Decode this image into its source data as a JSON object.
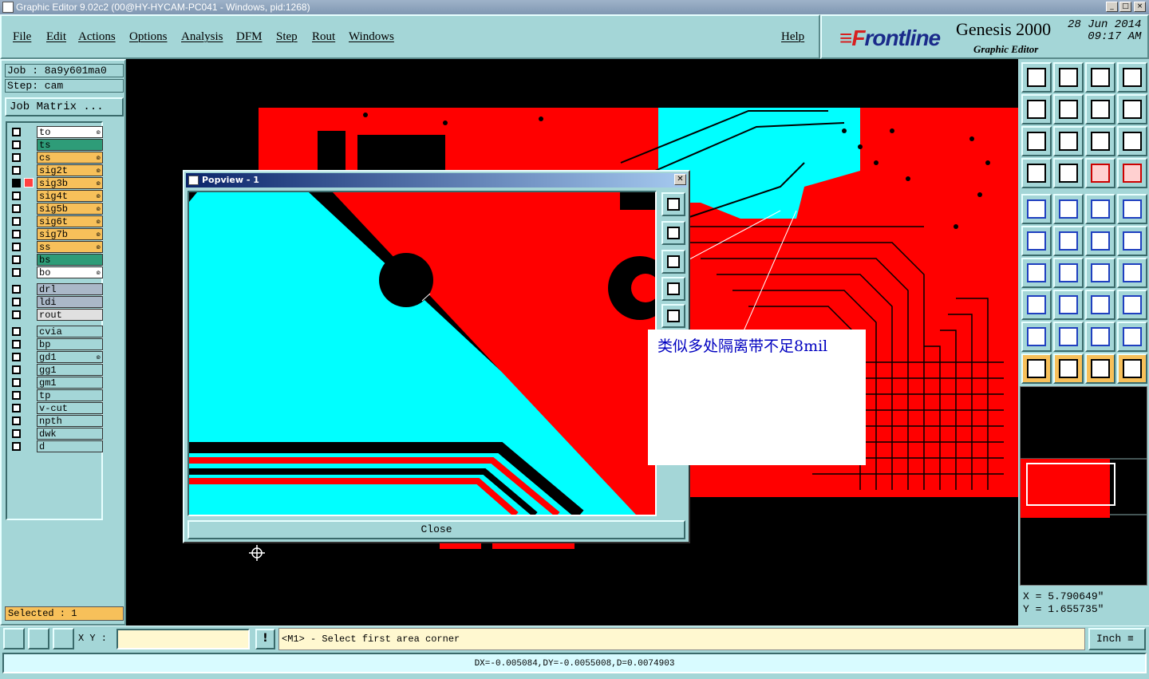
{
  "window": {
    "title": "Graphic Editor 9.02c2 (00@HY-HYCAM-PC041 - Windows, pid:1268)",
    "min": "_",
    "max": "□",
    "close": "×"
  },
  "menu": [
    "File",
    "Edit",
    "Actions",
    "Options",
    "Analysis",
    "DFM",
    "Step",
    "Rout",
    "Windows"
  ],
  "help": "Help",
  "brand": {
    "logo_f": "≡F",
    "logo_rest": "rontline",
    "product": "Genesis 2000",
    "subtitle": "Graphic Editor",
    "date": "28 Jun 2014",
    "time": "09:17 AM"
  },
  "job": {
    "job_line": "Job : 8a9y601ma0",
    "step_line": "Step: cam",
    "matrix_button": "Job Matrix ..."
  },
  "layers": [
    {
      "name": "to",
      "color": "#ffffff",
      "w": "๏"
    },
    {
      "name": "ts",
      "color": "#2e9c78",
      "w": ""
    },
    {
      "name": "cs",
      "color": "#f7c05a",
      "w": "๏"
    },
    {
      "name": "sig2t",
      "color": "#f7c05a",
      "w": "๏"
    },
    {
      "name": "sig3b",
      "color": "#f7c05a",
      "w": "๏"
    },
    {
      "name": "sig4t",
      "color": "#f7c05a",
      "w": "๏"
    },
    {
      "name": "sig5b",
      "color": "#f7c05a",
      "w": "๏"
    },
    {
      "name": "sig6t",
      "color": "#f7c05a",
      "w": "๏"
    },
    {
      "name": "sig7b",
      "color": "#f7c05a",
      "w": "๏"
    },
    {
      "name": "ss",
      "color": "#f7c05a",
      "w": "๏"
    },
    {
      "name": "bs",
      "color": "#2e9c78",
      "w": ""
    },
    {
      "name": "bo",
      "color": "#ffffff",
      "w": "๏"
    },
    {
      "name": "drl",
      "color": "#aab8c8",
      "w": ""
    },
    {
      "name": "ldi",
      "color": "#aab8c8",
      "w": ""
    },
    {
      "name": "rout",
      "color": "#e0e0e0",
      "w": ""
    },
    {
      "name": "cvia",
      "color": "#a4d6d7",
      "w": ""
    },
    {
      "name": "bp",
      "color": "#a4d6d7",
      "w": ""
    },
    {
      "name": "gd1",
      "color": "#a4d6d7",
      "w": "๏"
    },
    {
      "name": "gg1",
      "color": "#a4d6d7",
      "w": ""
    },
    {
      "name": "gm1",
      "color": "#a4d6d7",
      "w": ""
    },
    {
      "name": "tp",
      "color": "#a4d6d7",
      "w": ""
    },
    {
      "name": "v-cut",
      "color": "#a4d6d7",
      "w": ""
    },
    {
      "name": "npth",
      "color": "#a4d6d7",
      "w": ""
    },
    {
      "name": "dwk",
      "color": "#a4d6d7",
      "w": ""
    },
    {
      "name": "d",
      "color": "#a4d6d7",
      "w": ""
    }
  ],
  "selected": "Selected : 1",
  "popview": {
    "title": "Popview - 1",
    "close_label": "Close"
  },
  "annotation": "类似多处隔离带不足8mil",
  "coords": {
    "x": "X = 5.790649\"",
    "y": "Y = 1.655735\""
  },
  "bottom": {
    "xy_label": "X Y :",
    "xy_value": "",
    "bang": "!",
    "prompt": "<M1> - Select first area corner",
    "unit": "Inch ≡"
  },
  "status": "DX=-0.005084,DY=-0.0055008,D=0.0074903",
  "colors": {
    "panel": "#a4d6d7",
    "copper": "#ff0000",
    "plane": "#00ffff",
    "highlight": "#f7c05a"
  },
  "toolbar_icons": [
    "zoom-home-icon",
    "zoom-home-icon",
    "home-icon",
    "window-icon",
    "pan-left-icon",
    "pan-right-icon",
    "redraw-icon",
    "snap-icon",
    "zoom-fit-icon",
    "zoom-center-icon",
    "scale-icon",
    "help-icon",
    "measure-icon",
    "drill-icon",
    "layers-icon",
    "layers-icon",
    "select-icon",
    "feature-icon",
    "ruler-icon",
    "dot-icon",
    "connect-icon",
    "cross-icon",
    "add-pad-icon",
    "add-pad-icon",
    "line-icon",
    "line-icon",
    "arc-icon",
    "text-icon",
    "feature-icon",
    "line-icon",
    "frame-icon",
    "net-icon",
    "triangle-icon",
    "triangle-icon",
    "triangle-icon",
    "triangle-icon",
    "pointer-icon",
    "pointer-icon",
    "pointer-icon",
    "route-icon"
  ]
}
